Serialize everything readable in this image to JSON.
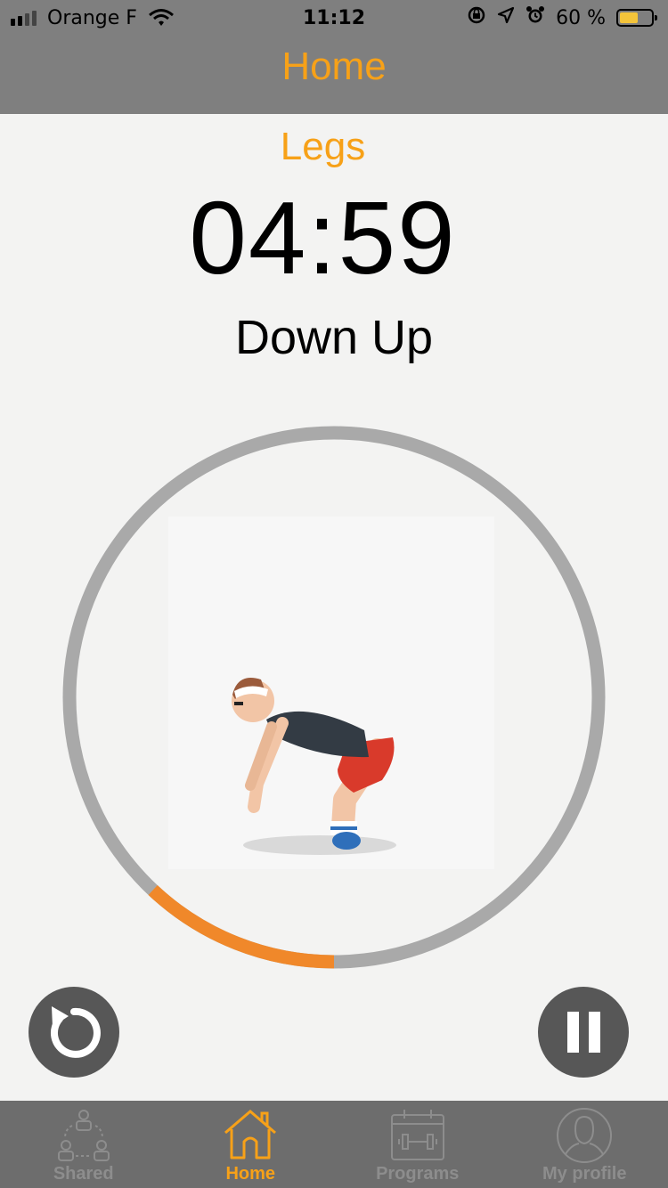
{
  "status_bar": {
    "carrier": "Orange F",
    "time": "11:12",
    "battery_percent": "60 %",
    "battery_level": 0.6,
    "icons": [
      "signal-icon",
      "wifi-icon",
      "orientation-lock-icon",
      "location-icon",
      "alarm-icon",
      "battery-icon"
    ]
  },
  "nav": {
    "title": "Home"
  },
  "workout": {
    "name": "Legs",
    "timer": "04:59",
    "exercise": "Down Up",
    "progress_arc_fraction": 0.12
  },
  "controls": {
    "restart_icon": "restart-icon",
    "pause_icon": "pause-icon"
  },
  "tabs": [
    {
      "label": "Shared",
      "icon": "shared-icon",
      "active": false
    },
    {
      "label": "Home",
      "icon": "home-icon",
      "active": true
    },
    {
      "label": "Programs",
      "icon": "programs-icon",
      "active": false
    },
    {
      "label": "My profile",
      "icon": "profile-icon",
      "active": false
    }
  ],
  "colors": {
    "accent": "#f7a118",
    "progress": "#f0882a",
    "ring": "#a9a9a9",
    "bar": "#7f7f7f",
    "tab_bar": "#6d6d6d",
    "button": "#575757"
  }
}
